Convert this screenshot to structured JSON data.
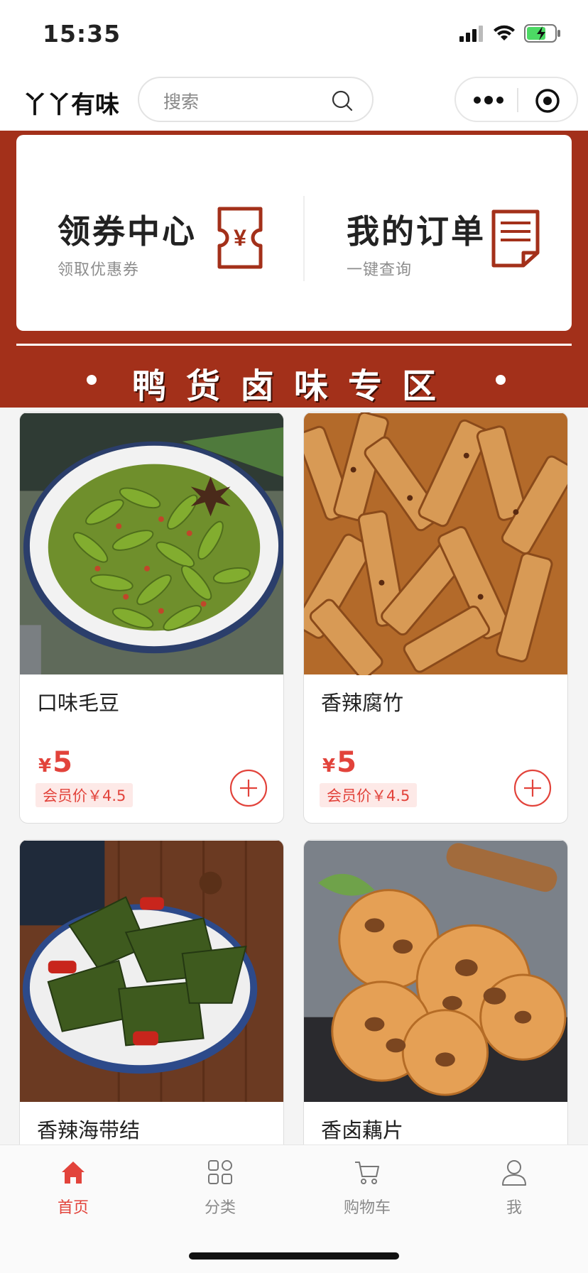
{
  "status": {
    "time": "15:35"
  },
  "nav": {
    "title": "丫丫有味",
    "search_placeholder": "搜索"
  },
  "banner": {
    "coupon_title": "领券中心",
    "coupon_sub": "领取优惠券",
    "coupon_icon_text": "¥",
    "orders_title": "我的订单",
    "orders_sub": "一键查询",
    "zone_title": "鸭货卤味专区"
  },
  "products": [
    {
      "name": "口味毛豆",
      "currency": "¥",
      "price": "5",
      "member_price": "会员价￥4.5"
    },
    {
      "name": "香辣腐竹",
      "currency": "¥",
      "price": "5",
      "member_price": "会员价￥4.5"
    },
    {
      "name": "香辣海带结"
    },
    {
      "name": "香卤藕片"
    }
  ],
  "tabs": [
    {
      "label": "首页",
      "icon": "home-icon",
      "active": true
    },
    {
      "label": "分类",
      "icon": "category-icon"
    },
    {
      "label": "购物车",
      "icon": "cart-icon"
    },
    {
      "label": "我",
      "icon": "user-icon"
    }
  ],
  "colors": {
    "accent": "#e2433b",
    "banner_bg": "#a3301a",
    "icon_brown": "#a3301a"
  }
}
